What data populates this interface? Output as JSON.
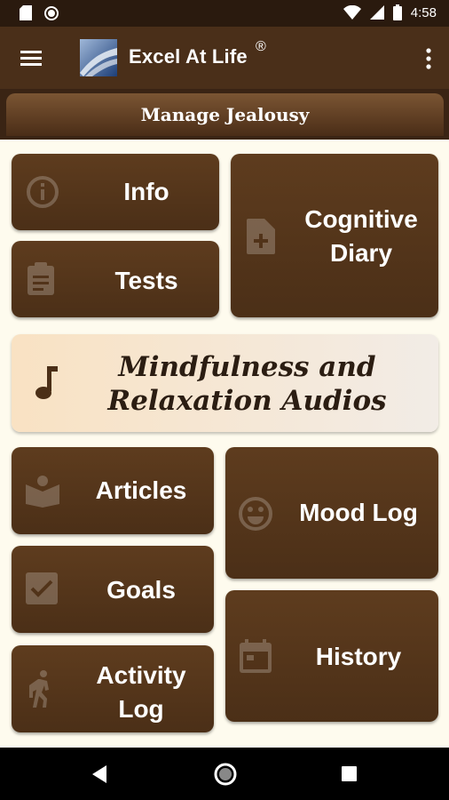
{
  "status": {
    "time": "4:58"
  },
  "app": {
    "title": "Excel At Life",
    "registered": "®"
  },
  "section": {
    "title": "Manage Jealousy"
  },
  "tiles": {
    "info": "Info",
    "tests": "Tests",
    "cognitive_diary_line1": "Cognitive",
    "cognitive_diary_line2": "Diary",
    "audio_line1": "Mindfulness and",
    "audio_line2": "Relaxation Audios",
    "articles": "Articles",
    "mood_log": "Mood Log",
    "goals": "Goals",
    "history": "History",
    "activity_log_line1": "Activity",
    "activity_log_line2": "Log"
  },
  "colors": {
    "brown": "#4b2f17",
    "cream": "#fefbee",
    "text_dark": "#2b1d12"
  },
  "icons": [
    "sd-card-icon",
    "circle-icon",
    "wifi-icon",
    "signal-icon",
    "battery-icon",
    "menu-icon",
    "overflow-menu-icon",
    "info-icon",
    "clipboard-icon",
    "add-file-icon",
    "music-note-icon",
    "book-icon",
    "smiley-icon",
    "checkbox-icon",
    "calendar-icon",
    "walking-icon",
    "back-icon",
    "home-icon",
    "recents-icon"
  ]
}
